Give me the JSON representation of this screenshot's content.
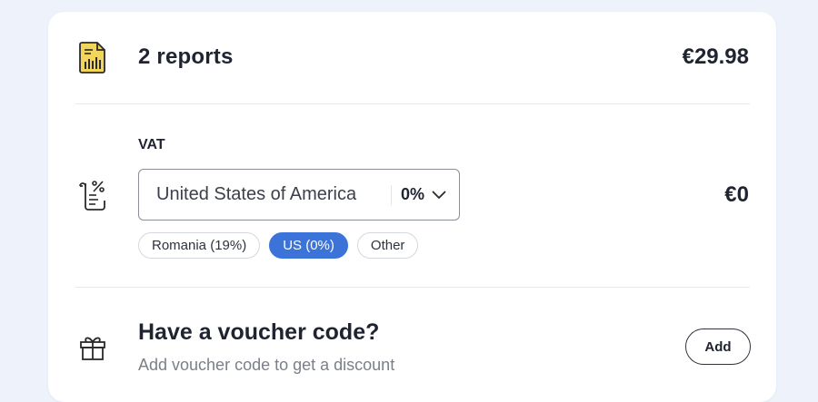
{
  "report": {
    "title": "2 reports",
    "price": "€29.98",
    "icon": "report-document-icon",
    "icon_color": "#f2d65b"
  },
  "vat": {
    "label": "VAT",
    "selected_country": "United States of America",
    "selected_rate": "0%",
    "amount": "€0",
    "icon": "receipt-percent-icon",
    "chips": [
      {
        "label": "Romania (19%)",
        "active": false
      },
      {
        "label": "US (0%)",
        "active": true
      },
      {
        "label": "Other",
        "active": false
      }
    ],
    "active_color": "#3b73d9"
  },
  "voucher": {
    "title": "Have a voucher code?",
    "subtitle": "Add voucher code to get a discount",
    "add_label": "Add",
    "icon": "gift-icon"
  }
}
